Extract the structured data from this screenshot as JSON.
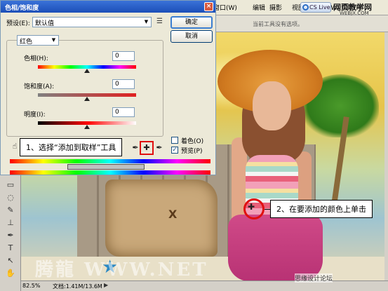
{
  "app": {
    "menu": [
      "窗口(W)",
      "编辑",
      "摄影",
      "视图(V)",
      "窗口(W)",
      "帮助(H)"
    ],
    "cs_live": "CS Live",
    "site_watermark_top": "网页教学网",
    "site_watermark_url": "WEBJX.COM",
    "options_hint": "当前工具没有选项。",
    "status": {
      "zoom": "82.5%",
      "doc": "文档:1.41M/13.6M"
    },
    "canvas_watermark": "腾龍 WWW.NET",
    "site_watermark_bottom": "思缘设计论坛"
  },
  "dialog": {
    "title": "色相/饱和度",
    "preset_label": "预设(E):",
    "preset_value": "默认值",
    "ok_label": "确定",
    "cancel_label": "取消",
    "channel_value": "红色",
    "hue_label": "色相(H):",
    "hue_value": "0",
    "saturation_label": "饱和度(A):",
    "saturation_value": "0",
    "lightness_label": "明度(I):",
    "lightness_value": "0",
    "colorize_label": "着色(O)",
    "colorize_checked": false,
    "preview_label": "预览(P)",
    "preview_checked": true
  },
  "callouts": {
    "step1": "1、选择“添加到取样”工具",
    "step2": "2、在要添加的颜色上单击"
  },
  "colors": {
    "accent_red": "#e01010",
    "titlebar": "#1c4fb8"
  }
}
